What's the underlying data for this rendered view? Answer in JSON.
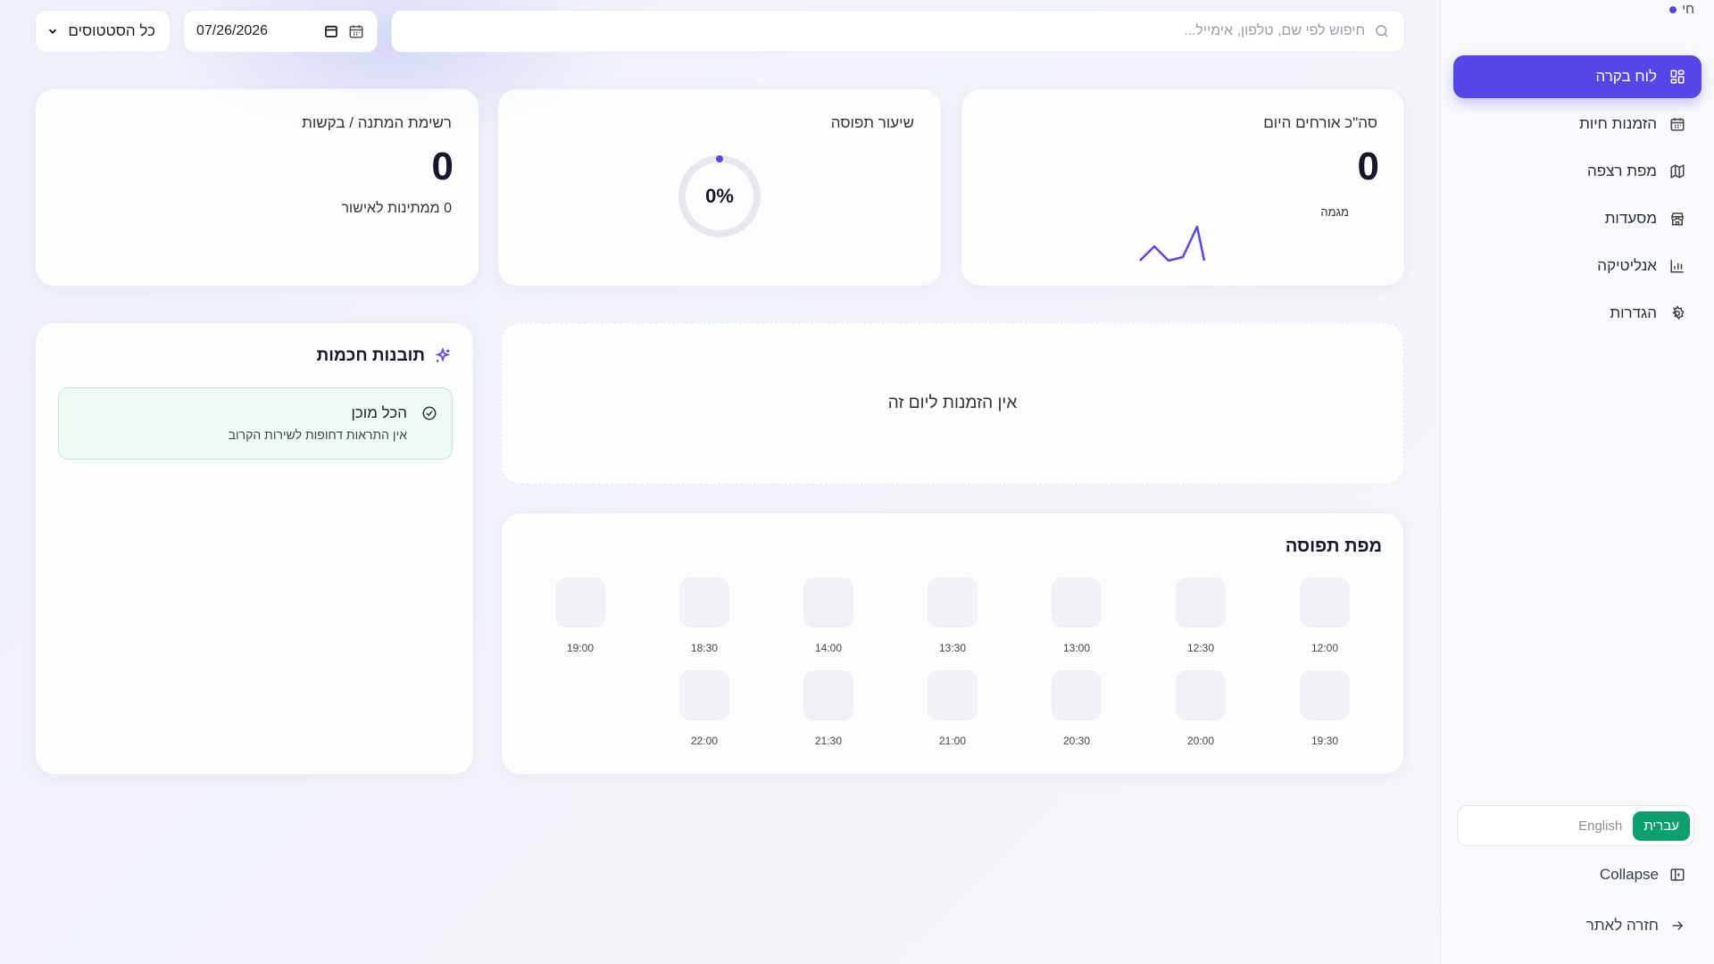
{
  "sidebar": {
    "top_label": "חי",
    "items": [
      {
        "label": "לוח בקרה",
        "icon": "dashboard-grid-icon",
        "active": true
      },
      {
        "label": "הזמנות חיות",
        "icon": "calendar-icon",
        "active": false
      },
      {
        "label": "מפת רצפה",
        "icon": "map-icon",
        "active": false
      },
      {
        "label": "מסעדות",
        "icon": "store-icon",
        "active": false
      },
      {
        "label": "אנליטיקה",
        "icon": "bar-chart-icon",
        "active": false
      },
      {
        "label": "הגדרות",
        "icon": "gear-icon",
        "active": false
      }
    ],
    "language": {
      "hebrew": "עברית",
      "english": "English",
      "selected": "hebrew"
    },
    "collapse_label": "Collapse",
    "back_label": "חזרה לאתר"
  },
  "toolbar": {
    "search_placeholder": "חיפוש לפי שם, טלפון, אימייל...",
    "date_value": "07/26/2026",
    "status_value": "כל הסטטוסים"
  },
  "stats": {
    "guests": {
      "title": "סה\"כ אורחים היום",
      "value": "0",
      "trend_label": "מגמה"
    },
    "occupancy": {
      "title": "שיעור תפוסה",
      "value": "0%",
      "percent": 0
    },
    "waitlist": {
      "title": "רשימת המתנה / בקשות",
      "value": "0",
      "sub": "0 ממתינות לאישור"
    }
  },
  "reservations": {
    "empty_text": "אין הזמנות ליום זה"
  },
  "occupancy_map": {
    "title": "מפת תפוסה",
    "slots": [
      "12:00",
      "12:30",
      "13:00",
      "13:30",
      "14:00",
      "18:30",
      "19:00",
      "19:30",
      "20:00",
      "20:30",
      "21:00",
      "21:30",
      "22:00"
    ]
  },
  "insights": {
    "title": "תובנות חכמות",
    "card_title": "הכל מוכן",
    "card_text": "אין התראות דחופות לשירות הקרוב"
  },
  "colors": {
    "accent": "#5546e8",
    "success": "#0e9f6e",
    "success_bg": "#effaf4"
  }
}
